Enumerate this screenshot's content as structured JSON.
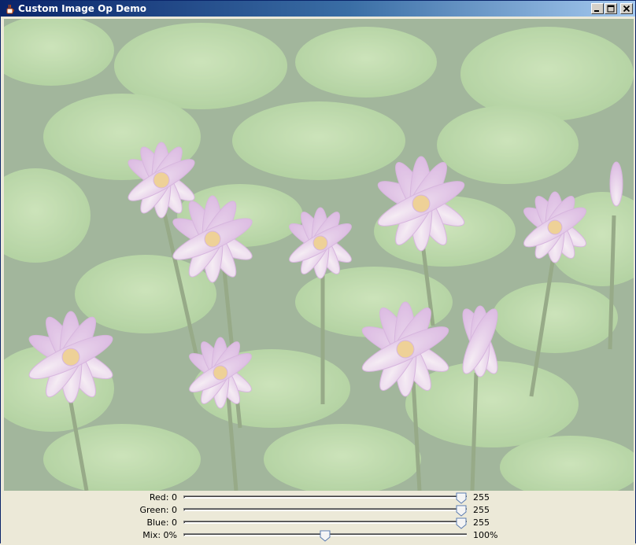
{
  "window": {
    "title": "Custom Image Op Demo"
  },
  "controls": [
    {
      "id": "red",
      "label": "Red: 0",
      "max_label": "255",
      "value": 255,
      "min": 0,
      "max": 255
    },
    {
      "id": "green",
      "label": "Green: 0",
      "max_label": "255",
      "value": 255,
      "min": 0,
      "max": 255
    },
    {
      "id": "blue",
      "label": "Blue: 0",
      "max_label": "255",
      "value": 255,
      "min": 0,
      "max": 255
    },
    {
      "id": "mix",
      "label": "Mix: 0%",
      "max_label": "100%",
      "value": 50,
      "min": 0,
      "max": 100
    }
  ],
  "colors": {
    "titlebar_start": "#0a246a",
    "titlebar_end": "#a6caf0",
    "panel": "#ece9d8"
  },
  "icons": [
    "java-cup-icon",
    "minimize-icon",
    "maximize-icon",
    "close-icon"
  ]
}
